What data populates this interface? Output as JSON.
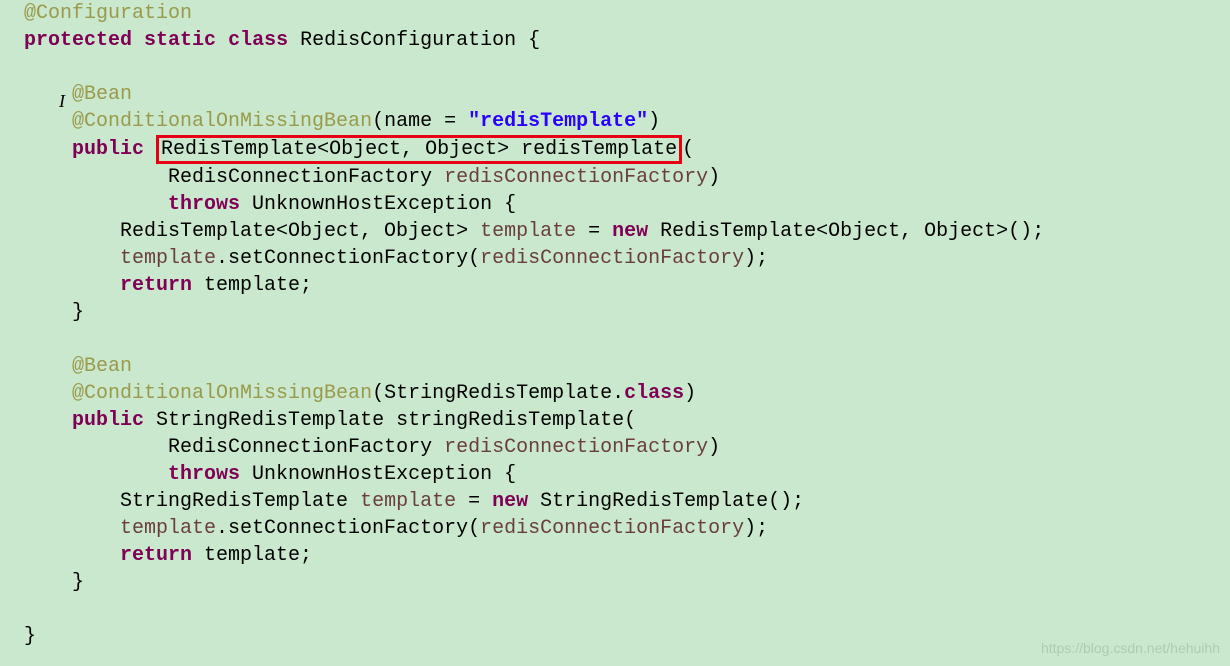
{
  "code": {
    "anno_config": "@Configuration",
    "kw_protected": "protected",
    "kw_static": "static",
    "kw_class": "class",
    "classname": "RedisConfiguration",
    "open_brace": "{",
    "close_brace": "}",
    "anno_bean": "@Bean",
    "anno_cond1_a": "@ConditionalOnMissingBean",
    "anno_cond1_b": "(name = ",
    "cond1_str": "\"redisTemplate\"",
    "cond1_c": ")",
    "kw_public": "public",
    "redbox_type": "RedisTemplate<Object, Object> redisTemplate",
    "paren_open": "(",
    "factory_type": "RedisConnectionFactory ",
    "factory_param": "redisConnectionFactory",
    "paren_close": ")",
    "kw_throws": "throws",
    "exception": " UnknownHostException ",
    "m1_line1_a": "RedisTemplate<Object, Object> ",
    "m1_line1_b": "template",
    "m1_line1_c": " = ",
    "kw_new": "new",
    "m1_line1_d": " RedisTemplate<Object, Object>();",
    "m1_line2_a": "template",
    "m1_line2_b": ".setConnectionFactory(",
    "m1_line2_c": "redisConnectionFactory",
    "m1_line2_d": ");",
    "kw_return": "return",
    "m1_line3_a": " template;",
    "anno_cond2_a": "@ConditionalOnMissingBean",
    "anno_cond2_b": "(StringRedisTemplate.",
    "kw_class2": "class",
    "anno_cond2_c": ")",
    "m2_sig": " StringRedisTemplate stringRedisTemplate(",
    "m2_line1_a": "StringRedisTemplate ",
    "m2_line1_b": "template",
    "m2_line1_c": " = ",
    "m2_line1_d": " StringRedisTemplate();"
  },
  "watermark": "https://blog.csdn.net/hehuihh"
}
